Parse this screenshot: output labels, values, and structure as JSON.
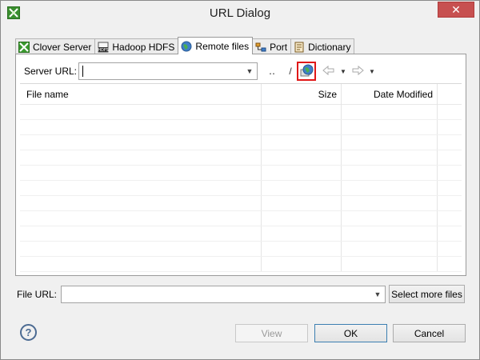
{
  "window": {
    "title": "URL Dialog",
    "close_glyph": "✕",
    "app_icon": "clover-app-icon"
  },
  "tabs": [
    {
      "label": "Clover Server",
      "icon": "clover-server-icon",
      "active": false
    },
    {
      "label": "Hadoop HDFS",
      "icon": "hdfs-icon",
      "active": false
    },
    {
      "label": "Remote files",
      "icon": "globe-icon",
      "active": true
    },
    {
      "label": "Port",
      "icon": "port-icon",
      "active": false
    },
    {
      "label": "Dictionary",
      "icon": "dictionary-icon",
      "active": false
    }
  ],
  "toolbar": {
    "server_url_label": "Server URL:",
    "server_url_value": "",
    "parent_dir_glyph": "‥",
    "root_dir_glyph": "/",
    "refresh_icon": "refresh-icon",
    "connect_icon": "connect-globe-icon",
    "back_icon": "back-arrow-icon",
    "forward_icon": "forward-arrow-icon"
  },
  "table": {
    "columns": [
      "File name",
      "Size",
      "Date Modified"
    ],
    "rows": []
  },
  "file_url": {
    "label": "File URL:",
    "value": "",
    "select_more_label": "Select more files"
  },
  "buttons": {
    "view": "View",
    "ok": "OK",
    "cancel": "Cancel",
    "help_glyph": "?"
  },
  "colors": {
    "highlight_border": "#e01818",
    "close_button": "#c75050",
    "dialog_bg": "#f0f0f0"
  }
}
